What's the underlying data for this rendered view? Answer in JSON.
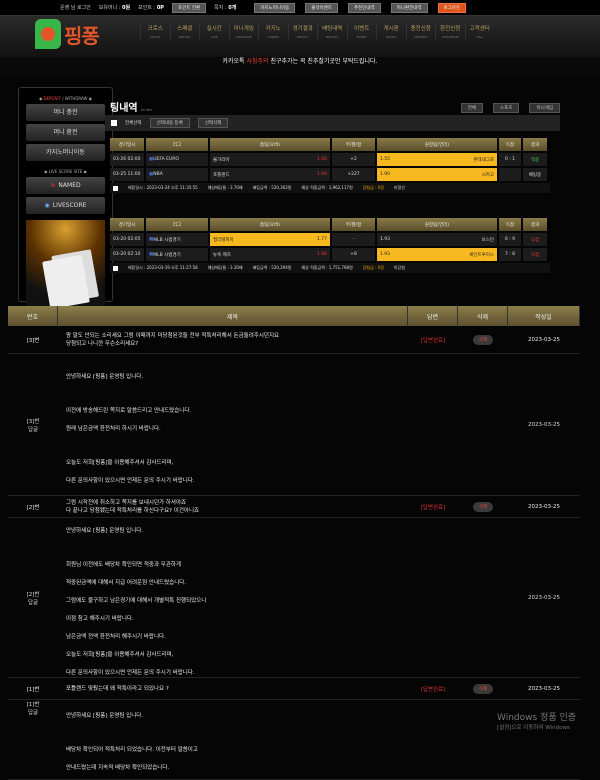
{
  "topbar": {
    "user": "운영 님 로그인",
    "money_label": "보유머니 : ",
    "money": "0원",
    "point_label": "포인트 : ",
    "point": "0P",
    "point_convert": "포인트 전환",
    "message_label": "쪽지 : ",
    "message": "0개",
    "buttons": [
      "카지노머니이동",
      "출석이벤트",
      "추천인내역",
      "머니환전내역",
      "로그아웃"
    ]
  },
  "logo": "핑퐁",
  "nav": [
    {
      "ko": "크로스",
      "en": "CROSS"
    },
    {
      "ko": "스페셜",
      "en": "SPECIAL"
    },
    {
      "ko": "실시간",
      "en": "LIVE"
    },
    {
      "ko": "미니게임",
      "en": "MINIGAME"
    },
    {
      "ko": "카지노",
      "en": "CASINO"
    },
    {
      "ko": "경기결과",
      "en": "RESULT"
    },
    {
      "ko": "배팅내역",
      "en": "BETLIST"
    },
    {
      "ko": "이벤트",
      "en": "EVENT"
    },
    {
      "ko": "게시판",
      "en": "BOARD"
    },
    {
      "ko": "충전신청",
      "en": "DEPOSIT"
    },
    {
      "ko": "환전신청",
      "en": "WITHDRAW"
    },
    {
      "ko": "고객센터",
      "en": "Q&A"
    }
  ],
  "notice": {
    "pre": "카카오톡 ",
    "hl": "사칭주의 ",
    "post": "친구추가는 꼭 친추찰기곳만 부탁드립니다."
  },
  "sidebar": {
    "title1_a": "DEPOSIT",
    "title1_b": " / WITHDRAW",
    "deposit": "머니 충전",
    "withdraw": "머니 환전",
    "casino": "카지노머니이동",
    "title2": "LIVE SCORE SITE",
    "named": "NAMED",
    "livescore": "LIVESCORE"
  },
  "main": {
    "title": "팅내역",
    "subtitle": "MY BET",
    "filters": [
      "전체",
      "스포츠",
      "미니게임"
    ],
    "select_all": "전체선택",
    "delete_selected_history": "선택내용 등록",
    "delete_selected": "선택삭제",
    "headers": [
      "경기일시",
      "리그",
      "홈팀(오버)",
      "무/핸/합",
      "원정팀(언더)",
      "득점",
      "결과"
    ],
    "bets": [
      {
        "rows": [
          {
            "date": "03-26 02:00",
            "league": "UEFA EURO",
            "home": "불가리아",
            "home_odds": "1.80",
            "mid": "+2",
            "away_odds": "1.55",
            "away": "몬테네그로",
            "score": "0 : 1",
            "result": "적중",
            "pick": "away",
            "res_color": "#55cc55"
          },
          {
            "date": "03-25 11:00",
            "league": "NBA",
            "home": "포틀랜드",
            "home_odds": "1.90",
            "mid": "+227",
            "away_odds": "1.90",
            "away": "시카고",
            "score": "",
            "result": "배팅중",
            "pick": "away",
            "res_color": "#dddddd"
          }
        ],
        "summary": {
          "time": "배팅일시 : 2023-03-24 오후 11:35:55",
          "odds": "예상배당율 : 3.70배",
          "amount": "배팅금액 : 530,302원",
          "expected": "예상 적중금액 : 1,962,117원",
          "win": "당첨금 : 0원",
          "status": "미정산"
        }
      },
      {
        "rows": [
          {
            "date": "03-20 02:05",
            "league": "MLB 시범경기",
            "home": "필라델피아",
            "home_odds": "1.77",
            "mid": "-",
            "away_odds": "1.93",
            "away": "보스턴",
            "score": "6 : 9",
            "result": "낙첨",
            "pick": "home",
            "res_color": "#ee3333"
          },
          {
            "date": "03-20 02:10",
            "league": "MLB 시범경기",
            "home": "뉴욕 메츠",
            "home_odds": "1.88",
            "mid": "+8",
            "away_odds": "1.93",
            "away": "세인트루이스",
            "score": "7 : 8",
            "result": "낙첨",
            "pick": "away",
            "res_color": "#ee3333"
          }
        ],
        "summary": {
          "time": "배팅일시 : 2023-03-19 오후 11:27:58",
          "odds": "예상배당율 : 3.30배",
          "amount": "배팅금액 : 530,294원",
          "expected": "예상 적중금액 : 1,751,768원",
          "win": "당첨금 : 0원",
          "status": "미당첨"
        }
      }
    ]
  },
  "board": {
    "headers": [
      "번호",
      "제목",
      "답변",
      "삭제",
      "작성일"
    ],
    "items": [
      {
        "no": "[3]번",
        "title": [
          "왕 말도 안되는 소리세요 그럼 이때까지 미당첨된것들 전부 적특처리해서 돈금돌려주시던지요",
          "당첨되고 나니깐 무슨소리세요?"
        ],
        "status": "[답변완료]",
        "del": "삭제",
        "date": "2023-03-25",
        "reply": {
          "no": "[3]번",
          "label": "답글",
          "date": "2023-03-25",
          "lines": [
            "안녕하세요 [핑퐁] 운영팀 입니다.",
            "",
            "이전에 방송해드린 쪽지로 말씀드리고 안내드렸습니다.",
            "원래 남은금액 환전처리 하시기 바랍니다.",
            "",
            "오늘도 저희[핑퐁]을 이용해주셔서 감사드리며,",
            "다른 문의사항이 있으시면 언제든 문의 주시기 바랍니다."
          ]
        }
      },
      {
        "no": "[2]번",
        "title": [
          "그럼 시작전에 취소하고 쪽지를 보내시던가 하셔야죠",
          "다 끝나고 당첨됐는데 적특처리를 하신다구요? 이건아니죠"
        ],
        "status": "[답변완료]",
        "del": "삭제",
        "date": "2023-03-25",
        "reply": {
          "no": "[2]번",
          "label": "답글",
          "date": "2023-03-25",
          "lines": [
            "안녕하세요 [핑퐁] 운영팀 입니다.",
            "",
            "회원님 이전에도 배당차 확인되면 적중과 무관하게",
            "적중된금액에 대해서 지급 어려운점 안내드렸습니다.",
            "그럼에도 불구하고 남은경기에 대해서 개별적특 진행되었으니",
            "이점 참고 해주시기 바랍니다.",
            "남은금액 전액 환전처리 해주시기 바랍니다.",
            "오늘도 저희[핑퐁]을 이용해주셔서 감사드리며,",
            "다른 문의사항이 있으시면 언제든 문의 주시기 바랍니다."
          ]
        }
      },
      {
        "no": "[1]번",
        "title": [
          "포틀랜드 맞췄는데 왜 적특이라고 되있나요 ?"
        ],
        "status": "[답변완료]",
        "del": "삭제",
        "date": "2023-03-25",
        "reply": {
          "no": "[1]번",
          "label": "답글",
          "date": "",
          "lines": [
            "안녕하세요 [핑퐁] 운영팀 입니다.",
            "",
            "배당차 확인되어 적특처리 되었습니다. 이전부터 말씀이고",
            "안내드렸는데 지속적 배당차 확인되었습니다."
          ]
        }
      }
    ]
  },
  "watermark": {
    "title": "Windows 정품 인증",
    "sub": "[설정]으로 이동하여 Windows"
  },
  "colors": {
    "accent_gold": "#8a7a48",
    "pick_yellow": "#f8b820",
    "logout_orange": "#e0551c",
    "logo_green": "#3ab54a"
  }
}
